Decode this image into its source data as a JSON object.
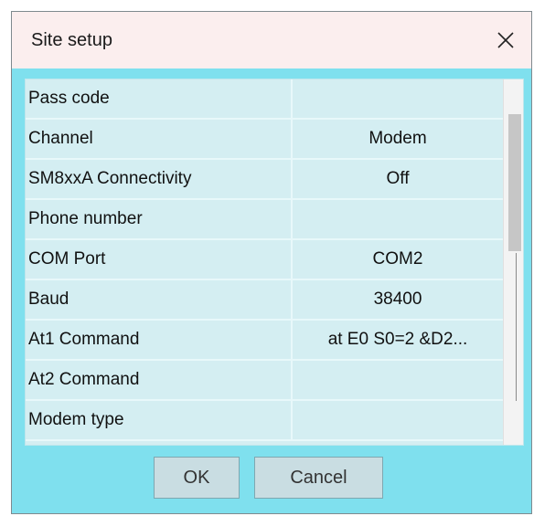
{
  "window": {
    "title": "Site setup",
    "close_icon": "close-icon"
  },
  "properties": [
    {
      "name": "Pass code",
      "value": ""
    },
    {
      "name": "Channel",
      "value": "Modem"
    },
    {
      "name": "SM8xxA Connectivity",
      "value": "Off"
    },
    {
      "name": "Phone number",
      "value": ""
    },
    {
      "name": "COM Port",
      "value": "COM2"
    },
    {
      "name": "Baud",
      "value": "38400"
    },
    {
      "name": "At1 Command",
      "value": "at E0 S0=2 &D2..."
    },
    {
      "name": "At2 Command",
      "value": ""
    },
    {
      "name": "Modem type",
      "value": ""
    }
  ],
  "buttons": {
    "ok_label": "OK",
    "cancel_label": "Cancel"
  },
  "colors": {
    "title_bar": "#fbeeee",
    "dialog_body": "#7fe0ee",
    "grid_cell": "#d4eef2"
  }
}
